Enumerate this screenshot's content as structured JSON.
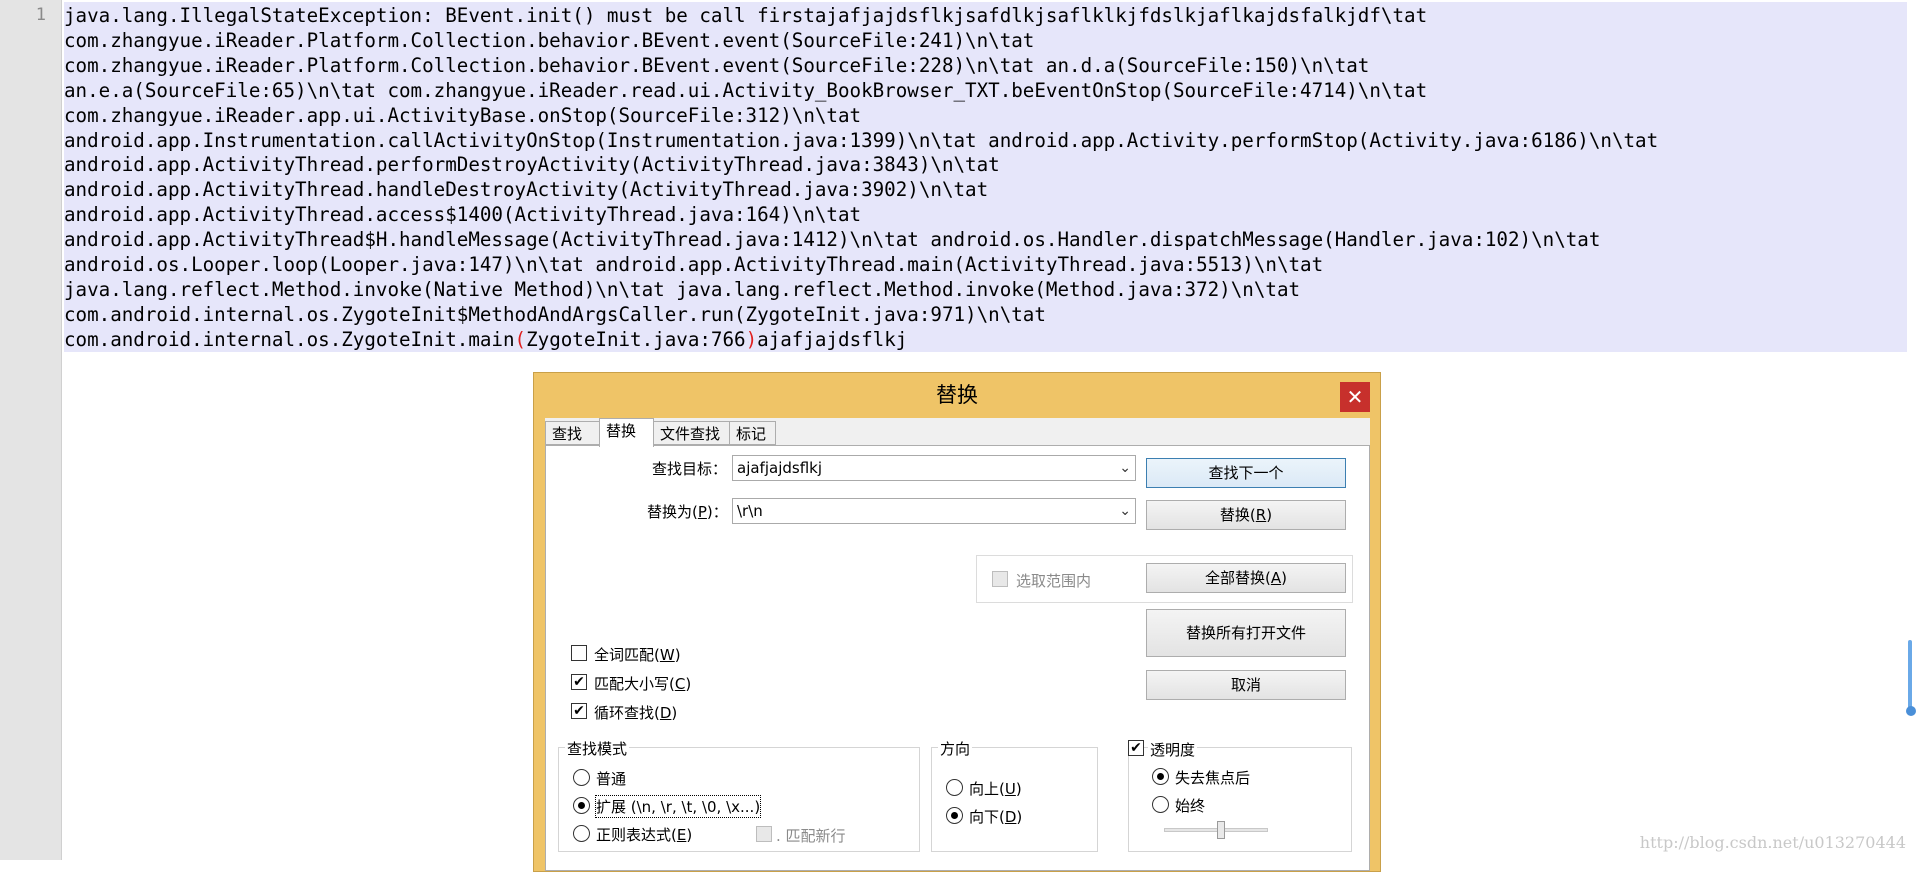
{
  "editor": {
    "line_number": "1",
    "lines": [
      "java.lang.IllegalStateException: BEvent.init() must be call firstajafjajdsflkjsafdlkjsaflklkjfdslkjaflkajdsfalkjdf\\tat",
      "com.zhangyue.iReader.Platform.Collection.behavior.BEvent.event(SourceFile:241)\\n\\tat",
      "com.zhangyue.iReader.Platform.Collection.behavior.BEvent.event(SourceFile:228)\\n\\tat an.d.a(SourceFile:150)\\n\\tat",
      "an.e.a(SourceFile:65)\\n\\tat com.zhangyue.iReader.read.ui.Activity_BookBrowser_TXT.beEventOnStop(SourceFile:4714)\\n\\tat",
      "com.zhangyue.iReader.app.ui.ActivityBase.onStop(SourceFile:312)\\n\\tat",
      "android.app.Instrumentation.callActivityOnStop(Instrumentation.java:1399)\\n\\tat android.app.Activity.performStop(Activity.java:6186)\\n\\tat",
      "android.app.ActivityThread.performDestroyActivity(ActivityThread.java:3843)\\n\\tat",
      "android.app.ActivityThread.handleDestroyActivity(ActivityThread.java:3902)\\n\\tat",
      "android.app.ActivityThread.access$1400(ActivityThread.java:164)\\n\\tat",
      "android.app.ActivityThread$H.handleMessage(ActivityThread.java:1412)\\n\\tat android.os.Handler.dispatchMessage(Handler.java:102)\\n\\tat",
      "android.os.Looper.loop(Looper.java:147)\\n\\tat android.app.ActivityThread.main(ActivityThread.java:5513)\\n\\tat",
      "java.lang.reflect.Method.invoke(Native Method)\\n\\tat java.lang.reflect.Method.invoke(Method.java:372)\\n\\tat",
      "com.android.internal.os.ZygoteInit$MethodAndArgsCaller.run(ZygoteInit.java:971)\\n\\tat"
    ],
    "last_line": {
      "prefix": "com.android.internal.os.ZygoteInit.main",
      "open_paren": "(",
      "middle": "ZygoteInit.java:766",
      "close_paren": ")",
      "suffix": "ajafjajdsflkj"
    },
    "selection_color": "#e6e6fa",
    "brace_highlight_color": "#e02020"
  },
  "watermark": "http://blog.csdn.net/u013270444",
  "dialog": {
    "title": "替换",
    "close_glyph": "✕",
    "tabs": [
      "查找",
      "替换",
      "文件查找",
      "标记"
    ],
    "active_tab": "替换",
    "find_label": "查找目标：",
    "find_value": "ajafjajdsflkj",
    "replace_label_pre": "替换为(",
    "replace_label_key": "P",
    "replace_label_post": ")：",
    "replace_value": "\\r\\n",
    "dropdown_glyph": "⌄",
    "in_selection_label": "选取范围内",
    "buttons": {
      "find_next": "查找下一个",
      "replace_pre": "替换(",
      "replace_key": "R",
      "replace_post": ")",
      "replace_all_pre": "全部替换(",
      "replace_all_key": "A",
      "replace_all_post": ")",
      "replace_all_open": "替换所有打开文件",
      "cancel": "取消"
    },
    "options": [
      {
        "pre": "全词匹配(",
        "key": "W",
        "post": ")",
        "checked": false
      },
      {
        "pre": "匹配大小写(",
        "key": "C",
        "post": ")",
        "checked": true
      },
      {
        "pre": "循环查找(",
        "key": "D",
        "post": ")",
        "checked": true
      }
    ],
    "check_glyph": "✔",
    "search_mode": {
      "title": "查找模式",
      "normal": "普通",
      "extended": "扩展 (\\n, \\r, \\t, \\0, \\x...)",
      "regex_pre": "正则表达式(",
      "regex_key": "E",
      "regex_post": ")",
      "match_newline": ". 匹配新行",
      "selected": "extended"
    },
    "direction": {
      "title": "方向",
      "up_pre": "向上(",
      "up_key": "U",
      "up_post": ")",
      "down_pre": "向下(",
      "down_key": "D",
      "down_post": ")",
      "selected": "down"
    },
    "transparency": {
      "title": "透明度",
      "enabled": true,
      "on_lose_focus": "失去焦点后",
      "always": "始终",
      "selected": "on_lose_focus",
      "level": 0.55
    },
    "title_bar_color": "#efc467",
    "close_color": "#c7302c"
  }
}
